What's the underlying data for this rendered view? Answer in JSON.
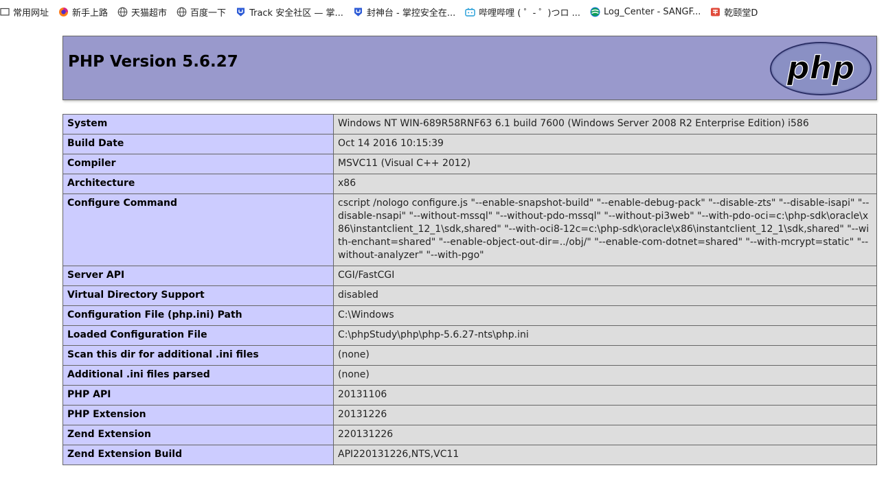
{
  "bookmarks": [
    {
      "label": "常用网址",
      "icon": "folder-icon"
    },
    {
      "label": "新手上路",
      "icon": "firefox-icon"
    },
    {
      "label": "天猫超市",
      "icon": "globe-icon"
    },
    {
      "label": "百度一下",
      "icon": "globe-icon"
    },
    {
      "label": "Track 安全社区 — 掌...",
      "icon": "shield-logo-icon"
    },
    {
      "label": "封神台 - 掌控安全在...",
      "icon": "shield-logo-icon"
    },
    {
      "label": "哔哩哔哩 ( ゜- ゜)つロ ...",
      "icon": "bilibili-icon"
    },
    {
      "label": "Log_Center - SANGF...",
      "icon": "sangfor-icon"
    },
    {
      "label": "乾颐堂D",
      "icon": "qianyitang-icon"
    }
  ],
  "header": {
    "title": "PHP Version 5.6.27",
    "logo_text": "php"
  },
  "rows": [
    {
      "key": "System",
      "value": "Windows NT WIN-689R58RNF63 6.1 build 7600 (Windows Server 2008 R2 Enterprise Edition) i586"
    },
    {
      "key": "Build Date",
      "value": "Oct 14 2016 10:15:39"
    },
    {
      "key": "Compiler",
      "value": "MSVC11 (Visual C++ 2012)"
    },
    {
      "key": "Architecture",
      "value": "x86"
    },
    {
      "key": "Configure Command",
      "value": "cscript /nologo configure.js \"--enable-snapshot-build\" \"--enable-debug-pack\" \"--disable-zts\" \"--disable-isapi\" \"--disable-nsapi\" \"--without-mssql\" \"--without-pdo-mssql\" \"--without-pi3web\" \"--with-pdo-oci=c:\\php-sdk\\oracle\\x86\\instantclient_12_1\\sdk,shared\" \"--with-oci8-12c=c:\\php-sdk\\oracle\\x86\\instantclient_12_1\\sdk,shared\" \"--with-enchant=shared\" \"--enable-object-out-dir=../obj/\" \"--enable-com-dotnet=shared\" \"--with-mcrypt=static\" \"--without-analyzer\" \"--with-pgo\""
    },
    {
      "key": "Server API",
      "value": "CGI/FastCGI"
    },
    {
      "key": "Virtual Directory Support",
      "value": "disabled"
    },
    {
      "key": "Configuration File (php.ini) Path",
      "value": "C:\\Windows"
    },
    {
      "key": "Loaded Configuration File",
      "value": "C:\\phpStudy\\php\\php-5.6.27-nts\\php.ini"
    },
    {
      "key": "Scan this dir for additional .ini files",
      "value": "(none)"
    },
    {
      "key": "Additional .ini files parsed",
      "value": "(none)"
    },
    {
      "key": "PHP API",
      "value": "20131106"
    },
    {
      "key": "PHP Extension",
      "value": "20131226"
    },
    {
      "key": "Zend Extension",
      "value": "220131226"
    },
    {
      "key": "Zend Extension Build",
      "value": "API220131226,NTS,VC11"
    }
  ]
}
